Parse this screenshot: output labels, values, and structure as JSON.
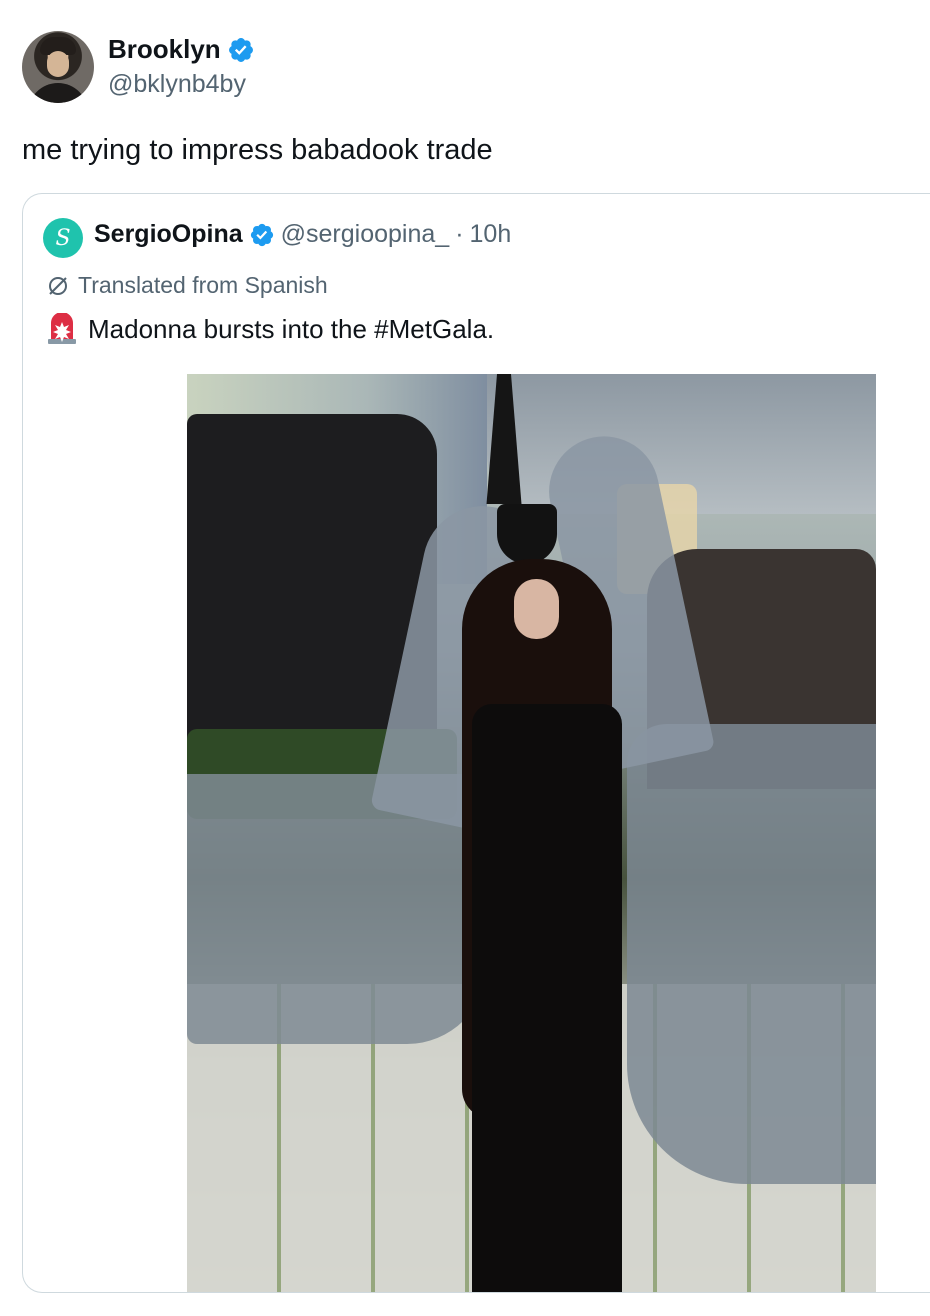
{
  "tweet": {
    "author": {
      "display_name": "Brooklyn",
      "handle": "@bklynb4by",
      "verified": true
    },
    "text": "me trying to impress babadook trade"
  },
  "quoted_tweet": {
    "author": {
      "display_name": "SergioOpina",
      "handle": "@sergioopina_",
      "verified": true,
      "avatar_letter": "S"
    },
    "separator": "·",
    "time": "10h",
    "translated_label": "Translated from Spanish",
    "text": "Madonna bursts into the #MetGala.",
    "emoji_icon": "police-car-light-icon"
  },
  "colors": {
    "verified": "#1d9bf0",
    "secondary_text": "#536471",
    "border": "#cfd9de",
    "quote_avatar": "#1fc3ad"
  }
}
